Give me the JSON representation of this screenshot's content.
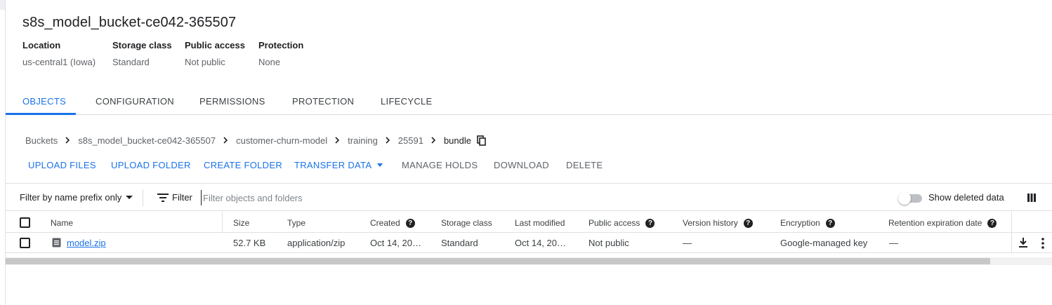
{
  "bucket": {
    "name": "s8s_model_bucket-ce042-365507",
    "meta": [
      {
        "key": "Location",
        "value": "us-central1 (Iowa)"
      },
      {
        "key": "Storage class",
        "value": "Standard"
      },
      {
        "key": "Public access",
        "value": "Not public"
      },
      {
        "key": "Protection",
        "value": "None"
      }
    ]
  },
  "tabs": [
    {
      "label": "OBJECTS",
      "active": true
    },
    {
      "label": "CONFIGURATION",
      "active": false
    },
    {
      "label": "PERMISSIONS",
      "active": false
    },
    {
      "label": "PROTECTION",
      "active": false
    },
    {
      "label": "LIFECYCLE",
      "active": false
    }
  ],
  "breadcrumb": [
    "Buckets",
    "s8s_model_bucket-ce042-365507",
    "customer-churn-model",
    "training",
    "25591",
    "bundle"
  ],
  "actions": {
    "upload_files": "UPLOAD FILES",
    "upload_folder": "UPLOAD FOLDER",
    "create_folder": "CREATE FOLDER",
    "transfer_data": "TRANSFER DATA",
    "manage_holds": "MANAGE HOLDS",
    "download": "DOWNLOAD",
    "delete": "DELETE"
  },
  "filter": {
    "prefix_mode": "Filter by name prefix only",
    "label": "Filter",
    "placeholder": "Filter objects and folders",
    "show_deleted": "Show deleted data",
    "show_deleted_on": false
  },
  "table": {
    "headers": {
      "name": "Name",
      "size": "Size",
      "type": "Type",
      "created": "Created",
      "storage_class": "Storage class",
      "last_modified": "Last modified",
      "public_access": "Public access",
      "version_history": "Version history",
      "encryption": "Encryption",
      "retention": "Retention expiration date"
    },
    "rows": [
      {
        "name": "model.zip",
        "size": "52.7 KB",
        "type": "application/zip",
        "created": "Oct 14, 20…",
        "storage_class": "Standard",
        "last_modified": "Oct 14, 20…",
        "public_access": "Not public",
        "version_history": "—",
        "encryption": "Google-managed key",
        "retention": "—"
      }
    ]
  },
  "colors": {
    "accent": "#1a73e8",
    "text": "#202124",
    "muted": "#5f6368",
    "divider": "#e0e0e0"
  }
}
